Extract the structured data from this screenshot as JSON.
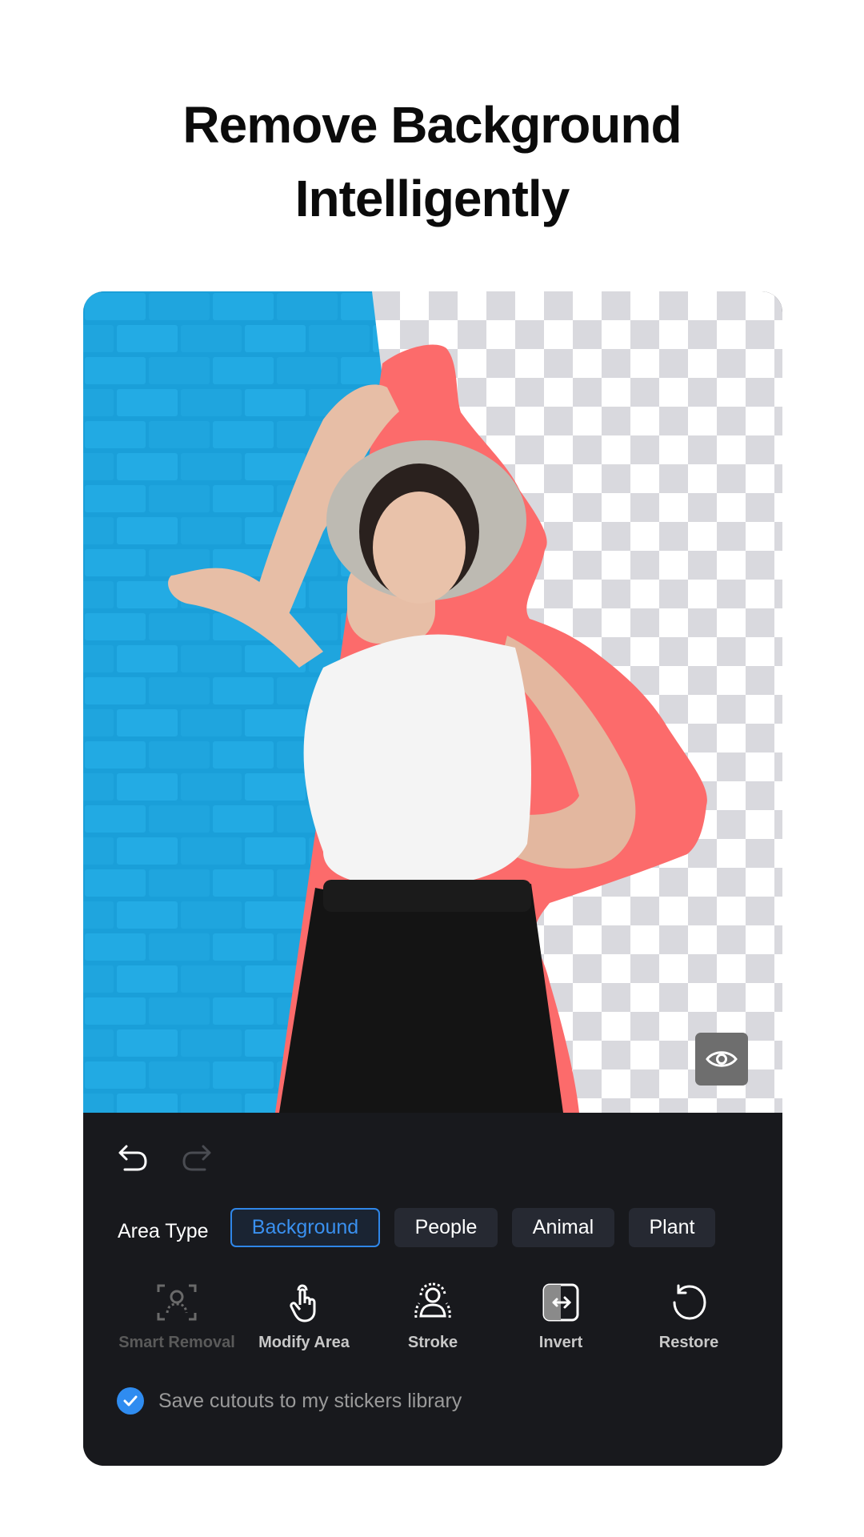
{
  "headline": {
    "line1": "Remove Background",
    "line2": "Intelligently"
  },
  "colors": {
    "accent": "#2f86e8",
    "stroke": "#fc6b6b",
    "brick": "#1ea0d8",
    "panel": "#18191d",
    "chip": "#262932"
  },
  "canvas": {
    "preview_icon": "eye-icon"
  },
  "history": {
    "undo_icon": "undo-icon",
    "redo_icon": "redo-icon",
    "redo_enabled": false
  },
  "area_type": {
    "label": "Area Type",
    "options": [
      {
        "label": "Background",
        "selected": true
      },
      {
        "label": "People",
        "selected": false
      },
      {
        "label": "Animal",
        "selected": false
      },
      {
        "label": "Plant",
        "selected": false
      }
    ]
  },
  "tools": [
    {
      "label": "Smart Removal",
      "icon": "person-scan-icon",
      "enabled": false
    },
    {
      "label": "Modify Area",
      "icon": "hand-pointer-icon",
      "enabled": true
    },
    {
      "label": "Stroke",
      "icon": "person-outline-icon",
      "enabled": true
    },
    {
      "label": "Invert",
      "icon": "invert-icon",
      "enabled": true
    },
    {
      "label": "Restore",
      "icon": "restore-icon",
      "enabled": true
    }
  ],
  "save_option": {
    "label": "Save cutouts to my stickers library",
    "checked": true
  }
}
